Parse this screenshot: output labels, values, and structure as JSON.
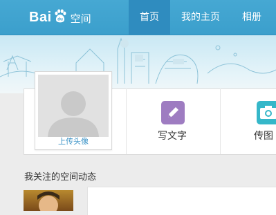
{
  "brand": {
    "logo_text_left": "Bai",
    "logo_text_right": "du",
    "logo_suffix": "空间"
  },
  "nav": {
    "items": [
      "首页",
      "我的主页",
      "相册"
    ],
    "active_index": 0
  },
  "profile": {
    "upload_label": "上传头像"
  },
  "actions": [
    {
      "label": "写文字",
      "icon": "pencil-icon",
      "color": "#9e7cc1"
    },
    {
      "label": "传图",
      "icon": "camera-icon",
      "color": "#35b7c9"
    }
  ],
  "feed": {
    "title": "我关注的空间动态"
  },
  "colors": {
    "topbar": "#3ea3cf",
    "nav_active": "#2f8cbf",
    "link": "#3b93c7"
  }
}
